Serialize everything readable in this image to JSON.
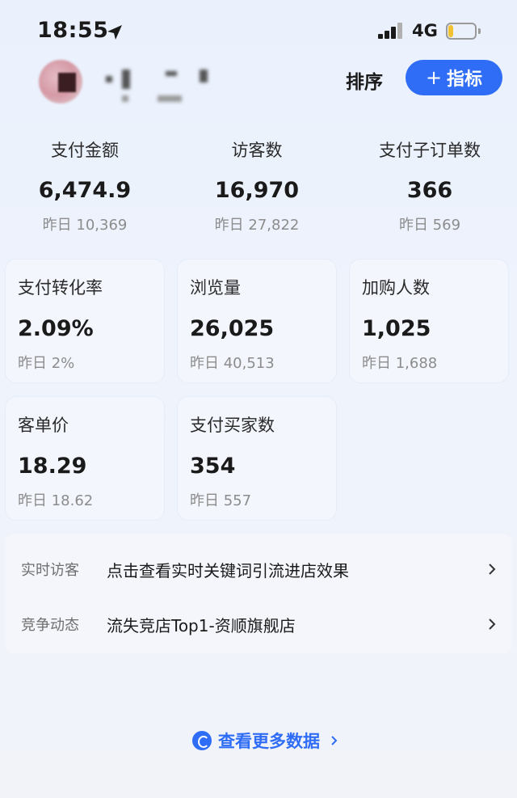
{
  "status_bar": {
    "time": "18:55",
    "network": "4G",
    "battery_level": 0.2,
    "icons": [
      "location-arrow-icon",
      "signal-icon",
      "battery-icon"
    ]
  },
  "header": {
    "sort_label": "排序",
    "add_metric_plus": "+",
    "add_metric_label": "指标",
    "accent_color": "#2f6df6"
  },
  "top_metrics": [
    {
      "label": "支付金额",
      "value": "6,474.9",
      "prev": "昨日 10,369"
    },
    {
      "label": "访客数",
      "value": "16,970",
      "prev": "昨日 27,822"
    },
    {
      "label": "支付子订单数",
      "value": "366",
      "prev": "昨日 569"
    }
  ],
  "cards": [
    {
      "label": "支付转化率",
      "value": "2.09%",
      "prev": "昨日 2%"
    },
    {
      "label": "浏览量",
      "value": "26,025",
      "prev": "昨日 40,513"
    },
    {
      "label": "加购人数",
      "value": "1,025",
      "prev": "昨日 1,688"
    },
    {
      "label": "客单价",
      "value": "18.29",
      "prev": "昨日 18.62"
    },
    {
      "label": "支付买家数",
      "value": "354",
      "prev": "昨日 557"
    }
  ],
  "info_rows": [
    {
      "key": "实时访客",
      "value": "点击查看实时关键词引流进店效果"
    },
    {
      "key": "竞争动态",
      "value": "流失竞店Top1-资顺旗舰店"
    }
  ],
  "footer": {
    "more_label": "查看更多数据"
  }
}
